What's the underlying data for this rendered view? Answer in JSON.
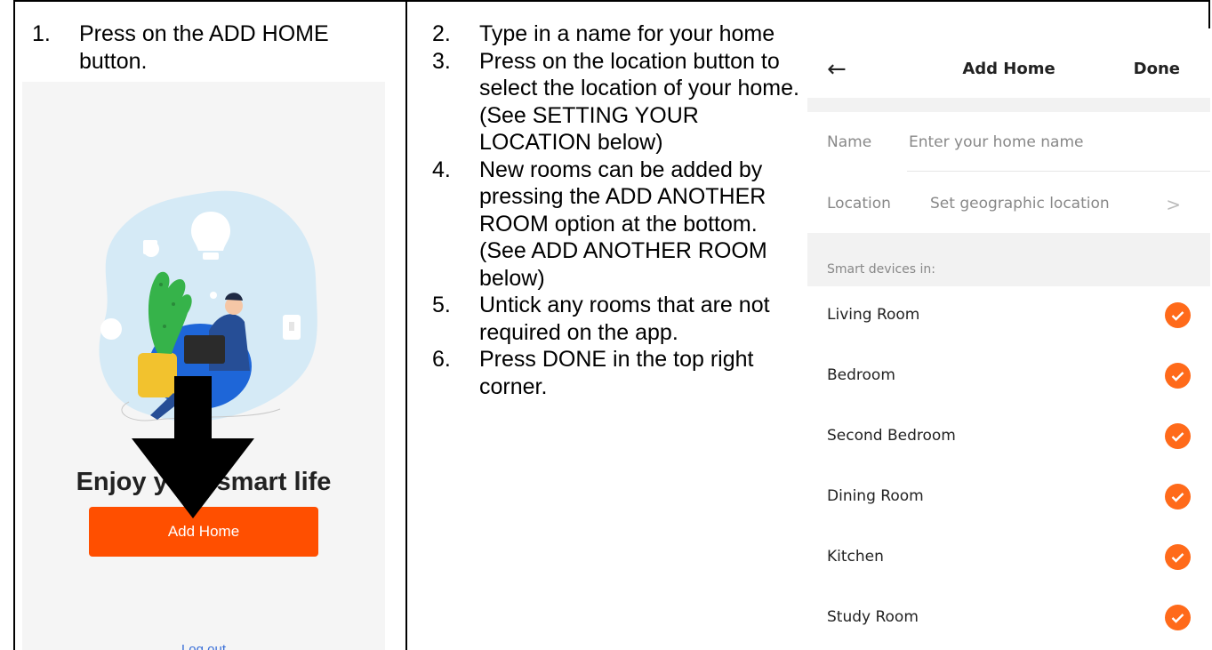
{
  "steps_left": [
    {
      "num": "1.",
      "text": "Press on the ADD HOME button."
    }
  ],
  "steps_right": [
    {
      "num": "2.",
      "text": "Type in a name for your home"
    },
    {
      "num": "3.",
      "text": "Press on the location button to select the location of your home.  (See SETTING YOUR LOCATION below)"
    },
    {
      "num": "4.",
      "text": "New rooms can be added by pressing the ADD ANOTHER ROOM option at the bottom. (See ADD ANOTHER ROOM below)"
    },
    {
      "num": "5.",
      "text": "Untick any rooms that are not required on the app."
    },
    {
      "num": "6.",
      "text": "Press DONE in the top right corner."
    }
  ],
  "screen1": {
    "title": "Enjoy your smart life",
    "add_home_label": "Add Home",
    "logout_label": "Log out",
    "overlay_icon": "arrow-down-icon"
  },
  "screen2": {
    "back_icon": "back-arrow-icon",
    "title": "Add Home",
    "done_label": "Done",
    "name_label": "Name",
    "name_placeholder": "Enter your home name",
    "location_label": "Location",
    "location_value": "Set geographic location",
    "chevron": ">",
    "section_label": "Smart devices in:",
    "rooms": [
      {
        "name": "Living Room",
        "checked": true
      },
      {
        "name": "Bedroom",
        "checked": true
      },
      {
        "name": "Second Bedroom",
        "checked": true
      },
      {
        "name": "Dining Room",
        "checked": true
      },
      {
        "name": "Kitchen",
        "checked": true
      },
      {
        "name": "Study Room",
        "checked": true
      }
    ],
    "accent_color": "#ff6a1a",
    "button_color": "#ff4f00"
  }
}
